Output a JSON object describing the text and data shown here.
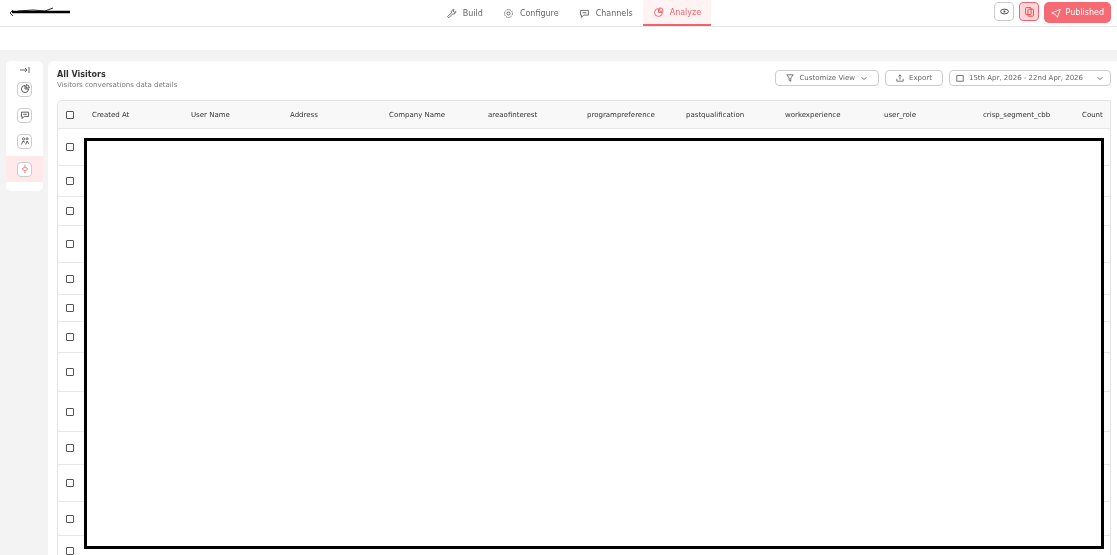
{
  "nav_tabs": [
    {
      "label": "Build",
      "selected": false
    },
    {
      "label": "Configure",
      "selected": false
    },
    {
      "label": "Channels",
      "selected": false
    },
    {
      "label": "Analyze",
      "selected": true
    }
  ],
  "header_actions": {
    "publish_label": "Published"
  },
  "sidebar": {
    "items": [
      {
        "selected": false
      },
      {
        "selected": false
      },
      {
        "selected": false
      },
      {
        "selected": true
      }
    ]
  },
  "panel": {
    "title": "All Visitors",
    "subtitle": "Visitors conversations data details",
    "customize_label": "Customize View",
    "export_label": "Export",
    "date_range": "15th Apr, 2026 - 22nd Apr, 2026"
  },
  "table": {
    "select_all_checked": false,
    "columns": [
      "Created At",
      "User Name",
      "Address",
      "Company Name",
      "areaofinterest",
      "programpreference",
      "pastqualification",
      "workexperience",
      "user_role",
      "crisp_segment_cbb",
      "Count"
    ],
    "rows": [
      {
        "checked": false
      },
      {
        "checked": false
      },
      {
        "checked": false
      },
      {
        "checked": false
      },
      {
        "checked": false
      },
      {
        "checked": false
      },
      {
        "checked": false
      },
      {
        "checked": false
      },
      {
        "checked": false
      },
      {
        "checked": false
      },
      {
        "checked": false
      },
      {
        "checked": false
      },
      {
        "checked": false
      }
    ]
  }
}
